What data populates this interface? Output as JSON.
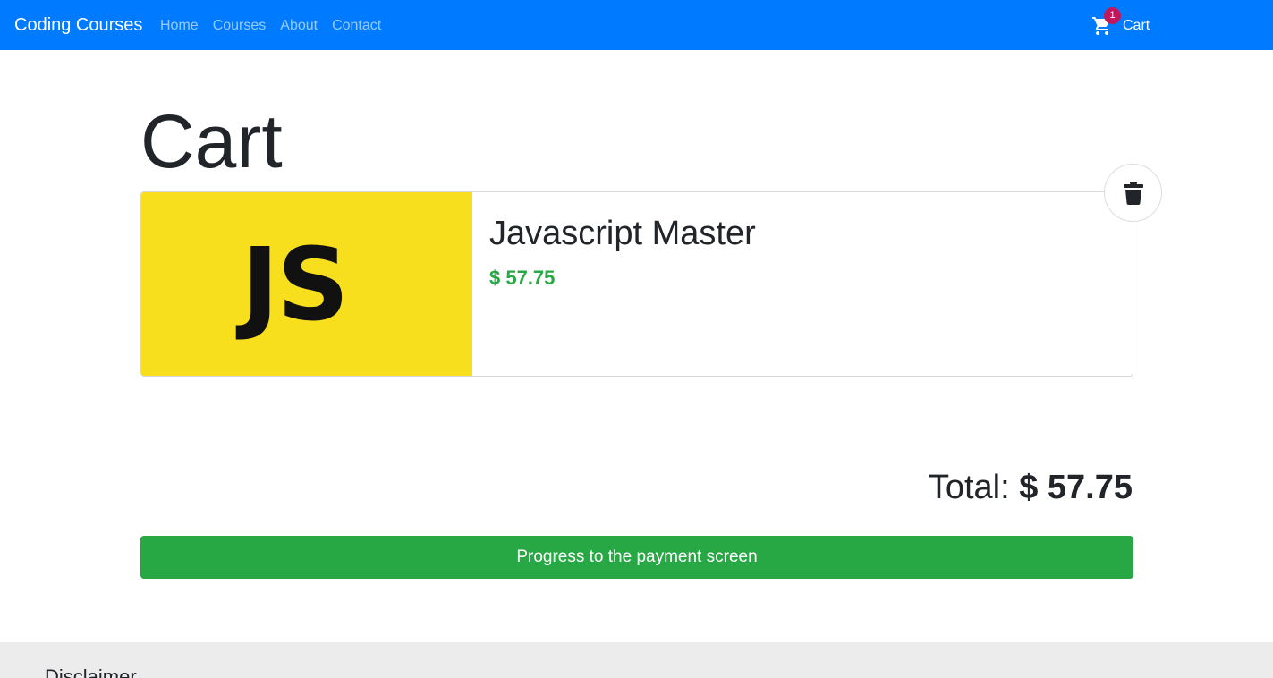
{
  "navbar": {
    "brand": "Coding Courses",
    "links": [
      "Home",
      "Courses",
      "About",
      "Contact"
    ],
    "cart_label": "Cart",
    "cart_count": "1"
  },
  "page": {
    "title": "Cart"
  },
  "cart_items": [
    {
      "logo_text": "JS",
      "title": "Javascript Master",
      "price": "$ 57.75"
    }
  ],
  "summary": {
    "total_label": "Total:",
    "total_value": "$ 57.75"
  },
  "checkout_button": "Progress to the payment screen",
  "footer": {
    "heading": "Disclaimer"
  },
  "colors": {
    "navbar": "#007bff",
    "price": "#28a745",
    "button": "#28a745",
    "badge": "#c2185b",
    "thumbnail": "#f7df1e"
  },
  "icons": {
    "cart": "cart-icon",
    "remove": "trash-icon"
  }
}
